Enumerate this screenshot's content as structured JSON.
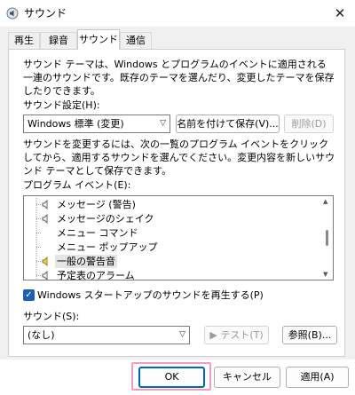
{
  "window": {
    "title": "サウンド",
    "close_glyph": "✕"
  },
  "tabs": [
    {
      "label": "再生"
    },
    {
      "label": "録音"
    },
    {
      "label": "サウンド"
    },
    {
      "label": "通信"
    }
  ],
  "scheme": {
    "description": "サウンド テーマは、Windows とプログラムのイベントに適用される一連のサウンドです。既存のテーマを選んだり、変更したテーマを保存したりできます。",
    "label": "サウンド設定(H):",
    "selected": "Windows 標準 (変更)",
    "save_as_label": "名前を付けて保存(V)...",
    "delete_label": "削除(D)"
  },
  "instructions": "サウンドを変更するには、次の一覧のプログラム イベントをクリックしてから、適用するサウンドを選んでください。変更内容を新しいサウンド テーマとして保存できます。",
  "events": {
    "label": "プログラム イベント(E):",
    "items": [
      {
        "label": "メッセージ (警告)",
        "has_sound": true,
        "selected": false
      },
      {
        "label": "メッセージのシェイク",
        "has_sound": true,
        "selected": false
      },
      {
        "label": "メニュー コマンド",
        "has_sound": false,
        "selected": false
      },
      {
        "label": "メニュー ポップアップ",
        "has_sound": false,
        "selected": false
      },
      {
        "label": "一般の警告音",
        "has_sound": true,
        "selected": true
      },
      {
        "label": "予定表のアラーム",
        "has_sound": true,
        "selected": false
      }
    ]
  },
  "startup": {
    "checked": true,
    "label": "Windows スタートアップのサウンドを再生する(P)"
  },
  "sound": {
    "label": "サウンド(S):",
    "selected": "(なし)",
    "test_label": "テスト(T)",
    "browse_label": "参照(B)..."
  },
  "footer": {
    "ok_label": "OK",
    "cancel_label": "キャンセル",
    "apply_label": "適用(A)"
  },
  "colors": {
    "accent": "#0067c0",
    "highlight": "#f29bbf"
  }
}
